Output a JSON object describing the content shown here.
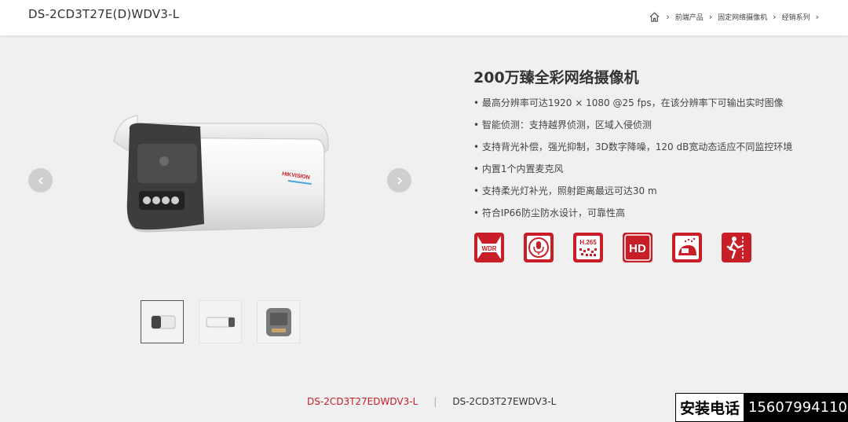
{
  "header": {
    "model": "DS-2CD3T27E(D)WDV3-L",
    "breadcrumbs": [
      "前端产品",
      "固定网络摄像机",
      "经销系列"
    ]
  },
  "gallery": {
    "prev_icon": "chevron-left-icon",
    "next_icon": "chevron-right-icon",
    "thumbnails": [
      "bullet-camera-front",
      "bullet-camera-side",
      "bullet-camera-dark"
    ]
  },
  "product": {
    "title": "200万臻全彩网络摄像机",
    "features": [
      "• 最高分辨率可达1920 × 1080 @25 fps，在该分辨率下可输出实时图像",
      "• 智能侦测：支持越界侦测，区域入侵侦测",
      "• 支持背光补偿，强光抑制，3D数字降噪，120 dB宽动态适应不同监控环境",
      "• 内置1个内置麦克风",
      "• 支持柔光灯补光，照射距离最远可达30 m",
      "• 符合IP66防尘防水设计，可靠性高"
    ],
    "badges": [
      {
        "icon": "wdr-icon",
        "text": "WDR"
      },
      {
        "icon": "microphone-icon",
        "text": ""
      },
      {
        "icon": "h265-icon",
        "text": "H.265"
      },
      {
        "icon": "hd-icon",
        "text": "HD"
      },
      {
        "icon": "weatherproof-icon",
        "text": ""
      },
      {
        "icon": "intrusion-icon",
        "text": ""
      }
    ],
    "brand_logo": "HIKVISION"
  },
  "variants": {
    "active": "DS-2CD3T27EDWDV3-L",
    "separator": "|",
    "other": "DS-2CD3T27EWDV3-L"
  },
  "phone": {
    "label": "安装电话",
    "number": "15607994110"
  },
  "colors": {
    "accent": "#c81e28",
    "background": "#f0f0f0"
  }
}
